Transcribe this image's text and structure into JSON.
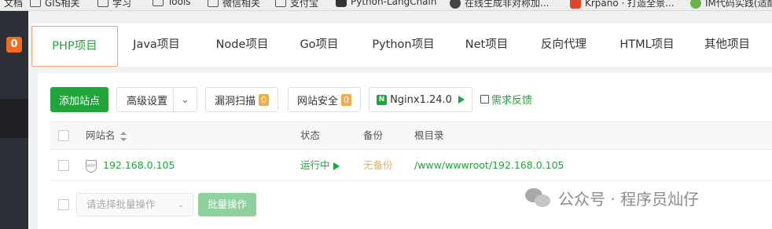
{
  "bookmarks": [
    {
      "label": "文档",
      "icon": "folder-icon"
    },
    {
      "label": "GIS相关",
      "icon": "folder-icon"
    },
    {
      "label": "学习",
      "icon": "folder-icon"
    },
    {
      "label": "Tools",
      "icon": "folder-icon"
    },
    {
      "label": "微信相关",
      "icon": "folder-icon"
    },
    {
      "label": "支付宝",
      "icon": "folder-icon"
    },
    {
      "label": "Python-LangChain",
      "icon": "github-icon"
    },
    {
      "label": "在线生成非对称加...",
      "icon": "globe-icon"
    },
    {
      "label": "Krpano · 打造全景...",
      "icon": "krpano-icon"
    },
    {
      "label": "IM代码实践(适配...",
      "icon": "im-icon"
    }
  ],
  "sidebar": {
    "badge": "0"
  },
  "tabs": [
    "PHP项目",
    "Java项目",
    "Node项目",
    "Go项目",
    "Python项目",
    "Net项目",
    "反向代理",
    "HTML项目",
    "其他项目"
  ],
  "toolbar": {
    "add_site": "添加站点",
    "advanced": "高级设置",
    "vuln_scan": "漏洞扫描",
    "vuln_count": "0",
    "site_security": "网站安全",
    "security_count": "0",
    "nginx": "Nginx1.24.0",
    "feedback": "需求反馈"
  },
  "table": {
    "headers": {
      "name": "网站名",
      "status": "状态",
      "backup": "备份",
      "root": "根目录"
    },
    "rows": [
      {
        "name": "192.168.0.105",
        "status": "运行中",
        "backup": "无备份",
        "root": "/www/wwwroot/192.168.0.105"
      }
    ]
  },
  "batch": {
    "placeholder": "请选择批量操作",
    "button": "批量操作"
  },
  "watermark": {
    "text": "公众号 · 程序员灿仔"
  },
  "colors": {
    "accent": "#20a53a",
    "badge": "#f06a1f",
    "warning": "#f0ad4e"
  }
}
